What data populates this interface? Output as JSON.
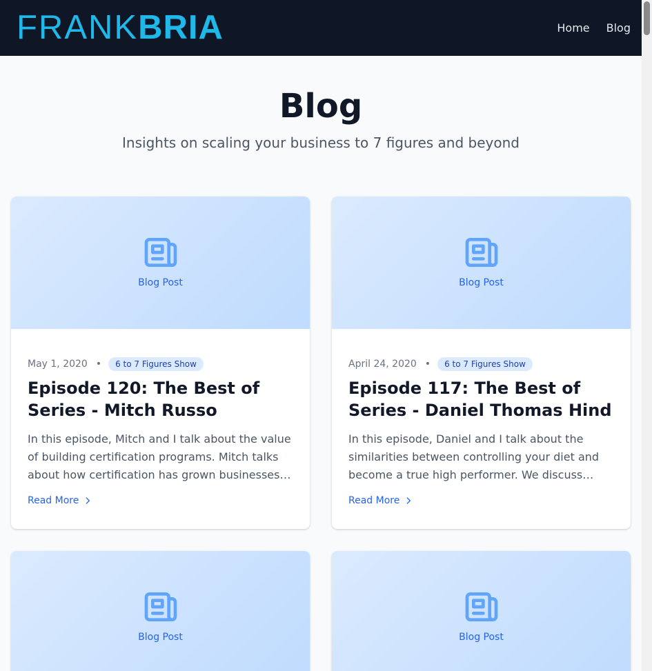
{
  "header": {
    "logo_light": "FRANK",
    "logo_bold": "BRIA",
    "nav": [
      {
        "label": "Home"
      },
      {
        "label": "Blog"
      }
    ]
  },
  "hero": {
    "title": "Blog",
    "subtitle": "Insights on scaling your business to 7 figures and beyond"
  },
  "cards": [
    {
      "image_label": "Blog Post",
      "image_icon": "newspaper-icon",
      "date": "May 1, 2020",
      "category": "6 to 7 Figures Show",
      "title": "Episode 120: The Best of Series - Mitch Russo",
      "excerpt": "In this episode, Mitch and I talk about the value of building certification programs. Mitch talks about how certification has grown businesses…",
      "read_more": "Read More"
    },
    {
      "image_label": "Blog Post",
      "image_icon": "newspaper-icon",
      "date": "April 24, 2020",
      "category": "6 to 7 Figures Show",
      "title": "Episode 117: The Best of Series - Daniel Thomas Hind",
      "excerpt": "In this episode, Daniel and I talk about the similarities between controlling your diet and become a true high performer. We discuss…",
      "read_more": "Read More"
    },
    {
      "image_label": "Blog Post",
      "image_icon": "newspaper-icon"
    },
    {
      "image_label": "Blog Post",
      "image_icon": "newspaper-icon"
    }
  ],
  "colors": {
    "header_bg": "#0f1726",
    "logo": "#1fb8e8",
    "accent": "#2563eb",
    "badge_bg": "#dbeafe",
    "badge_text": "#1e40af"
  }
}
